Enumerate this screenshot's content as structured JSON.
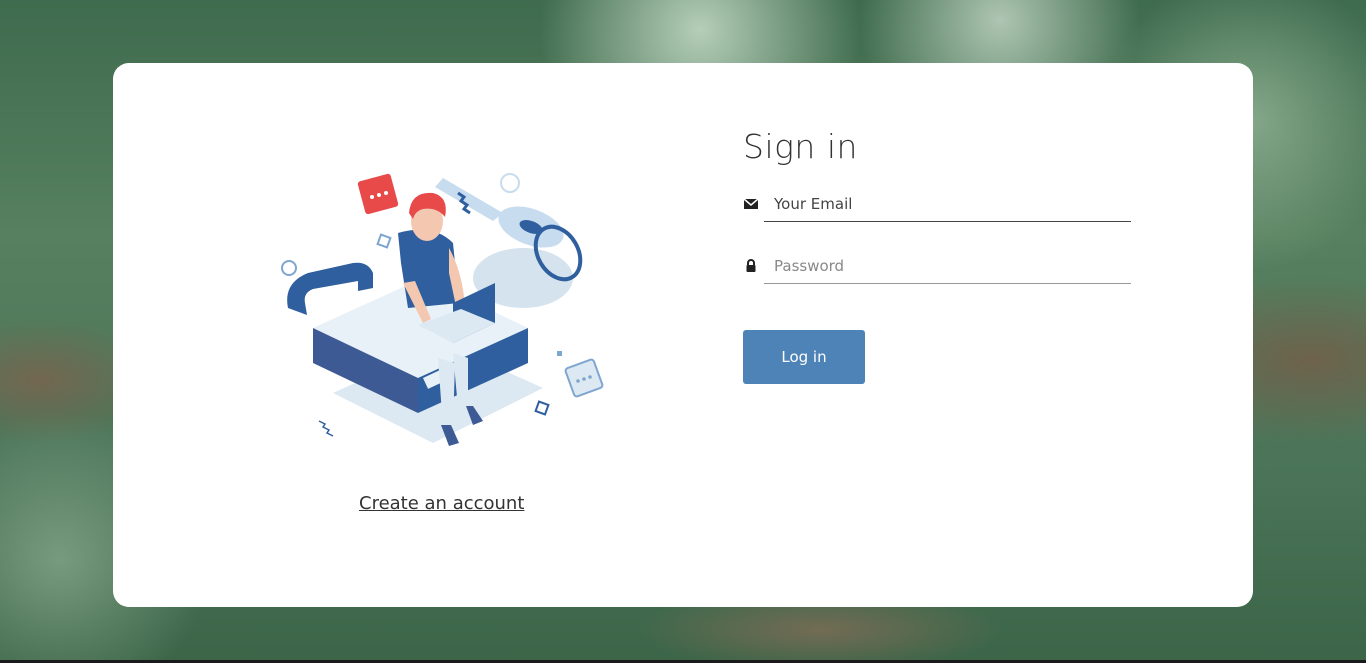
{
  "signin": {
    "title": "Sign in",
    "email_placeholder": "Your Email",
    "password_placeholder": "Password",
    "login_label": "Log in",
    "create_account_label": "Create an account"
  },
  "icons": {
    "email": "envelope-icon",
    "password": "lock-icon",
    "illustration": "user-with-laptop-lock-key-illustration"
  },
  "colors": {
    "accent": "#4e83b8",
    "illustration_blue": "#2f5f9e",
    "illustration_red": "#e84a4a",
    "card_bg": "#ffffff"
  }
}
